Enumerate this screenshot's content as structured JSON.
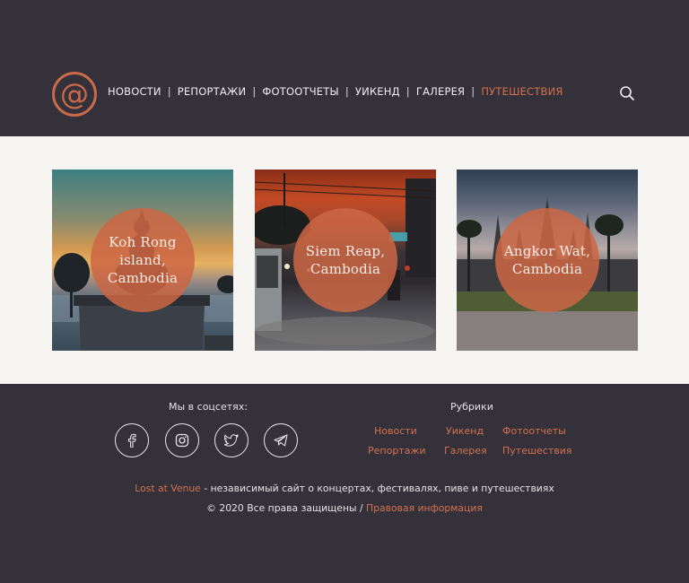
{
  "header": {
    "logo_symbol": "@",
    "nav": [
      {
        "label": "НОВОСТИ",
        "active": false
      },
      {
        "label": "РЕПОРТАЖИ",
        "active": false
      },
      {
        "label": "ФОТООТЧЕТЫ",
        "active": false
      },
      {
        "label": "УИКЕНД",
        "active": false
      },
      {
        "label": "ГАЛЕРЕЯ",
        "active": false
      },
      {
        "label": "ПУТЕШЕСТВИЯ",
        "active": true
      }
    ],
    "search_icon": "search-icon"
  },
  "cards": [
    {
      "line1": "Koh Rong island,",
      "line2": "Cambodia"
    },
    {
      "line1": "Siem Reap,",
      "line2": "Cambodia"
    },
    {
      "line1": "Angkor Wat,",
      "line2": "Cambodia"
    }
  ],
  "footer": {
    "social_title": "Мы в соцсетях:",
    "social_icons": [
      "facebook-icon",
      "instagram-icon",
      "twitter-icon",
      "telegram-icon"
    ],
    "rubrics_title": "Рубрики",
    "rubrics": [
      "Новости",
      "Уикенд",
      "Фотоотчеты",
      "Репортажи",
      "Галерея",
      "Путешествия"
    ],
    "about_brand": "Lost at Venue",
    "about_text": " - независимый сайт о концертах, фестивалях, пиве и путешествиях",
    "copyright": "© 2020 Все права защищены / ",
    "legal_link": "Правовая информация"
  },
  "colors": {
    "background": "#34313a",
    "accent": "#d2714e",
    "content_bg": "#f7f5f1"
  }
}
